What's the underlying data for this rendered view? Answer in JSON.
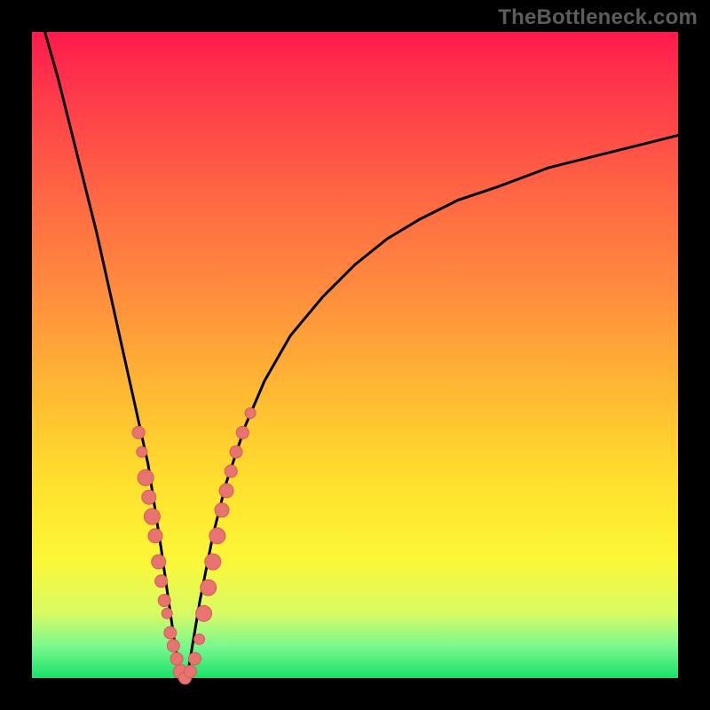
{
  "watermark": "TheBottleneck.com",
  "colors": {
    "frame": "#000000",
    "gradient_top": "#ff1a4d",
    "gradient_bottom": "#18e06a",
    "curve": "#000000",
    "marker_fill": "#e77470",
    "marker_stroke": "#d85b56"
  },
  "chart_data": {
    "type": "line",
    "title": "",
    "xlabel": "",
    "ylabel": "",
    "xlim": [
      0,
      100
    ],
    "ylim": [
      0,
      100
    ],
    "grid": false,
    "notes": "Bottleneck-style curve. y-axis shows bottleneck percentage (high=red=bad, 0=green=optimal). Curve reaches 0 near x≈23 and rises on both sides. Salmon markers cluster near the minimum on both branches.",
    "series": [
      {
        "name": "bottleneck-curve",
        "x": [
          2,
          4,
          6,
          8,
          10,
          12,
          14,
          16,
          18,
          20,
          21,
          22,
          23,
          24,
          25,
          26,
          28,
          30,
          33,
          36,
          40,
          45,
          50,
          55,
          60,
          66,
          72,
          80,
          88,
          96,
          100
        ],
        "y": [
          100,
          93,
          85,
          77,
          69,
          60,
          51,
          42,
          33,
          20,
          13,
          6,
          0,
          0,
          6,
          12,
          22,
          30,
          39,
          46,
          53,
          59,
          64,
          68,
          71,
          74,
          76,
          79,
          81,
          83,
          84
        ]
      }
    ],
    "markers": [
      {
        "x": 16.5,
        "y": 38,
        "r": 7
      },
      {
        "x": 17.0,
        "y": 35,
        "r": 6
      },
      {
        "x": 17.6,
        "y": 31,
        "r": 9
      },
      {
        "x": 18.1,
        "y": 28,
        "r": 8
      },
      {
        "x": 18.6,
        "y": 25,
        "r": 9
      },
      {
        "x": 19.1,
        "y": 22,
        "r": 8
      },
      {
        "x": 19.6,
        "y": 18,
        "r": 8
      },
      {
        "x": 20.0,
        "y": 15,
        "r": 7
      },
      {
        "x": 20.5,
        "y": 12,
        "r": 7
      },
      {
        "x": 20.9,
        "y": 10,
        "r": 6
      },
      {
        "x": 21.4,
        "y": 7,
        "r": 7
      },
      {
        "x": 21.9,
        "y": 5,
        "r": 7
      },
      {
        "x": 22.4,
        "y": 3,
        "r": 7
      },
      {
        "x": 23.0,
        "y": 1,
        "r": 8
      },
      {
        "x": 23.7,
        "y": 0,
        "r": 7
      },
      {
        "x": 24.5,
        "y": 1,
        "r": 7
      },
      {
        "x": 25.2,
        "y": 3,
        "r": 7
      },
      {
        "x": 25.9,
        "y": 6,
        "r": 6
      },
      {
        "x": 26.6,
        "y": 10,
        "r": 9
      },
      {
        "x": 27.3,
        "y": 14,
        "r": 9
      },
      {
        "x": 28.0,
        "y": 18,
        "r": 9
      },
      {
        "x": 28.7,
        "y": 22,
        "r": 9
      },
      {
        "x": 29.4,
        "y": 26,
        "r": 8
      },
      {
        "x": 30.1,
        "y": 29,
        "r": 8
      },
      {
        "x": 30.8,
        "y": 32,
        "r": 7
      },
      {
        "x": 31.6,
        "y": 35,
        "r": 7
      },
      {
        "x": 32.6,
        "y": 38,
        "r": 7
      },
      {
        "x": 33.8,
        "y": 41,
        "r": 6
      }
    ]
  }
}
